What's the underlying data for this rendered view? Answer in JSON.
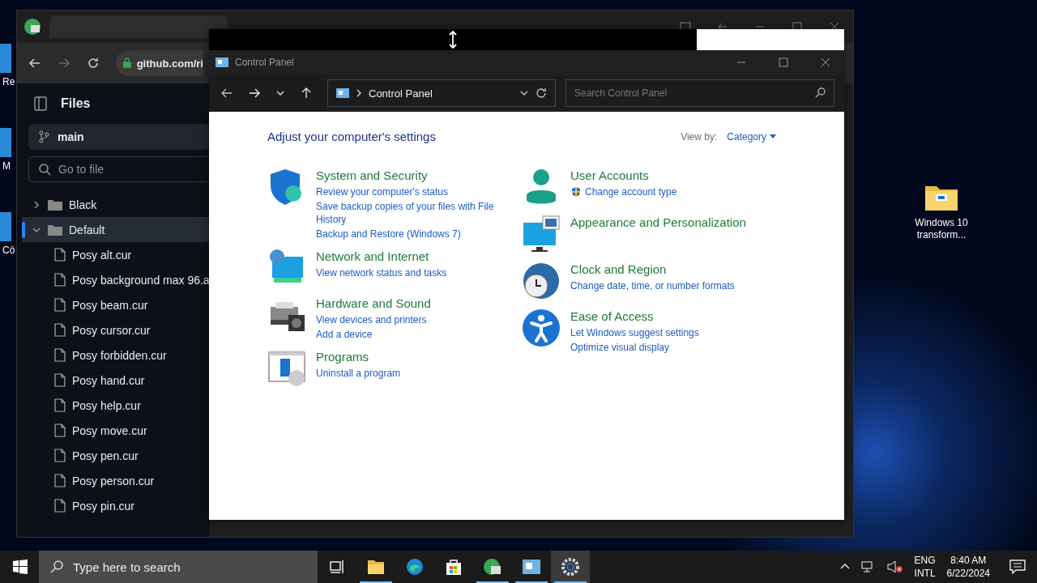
{
  "desktop": {
    "icons_left": [
      {
        "label": "Re"
      },
      {
        "label": "M"
      },
      {
        "label": "Cö"
      }
    ],
    "icons_right": [
      {
        "label": "Windows 10 transform..."
      }
    ]
  },
  "browser": {
    "address": "github.com/ri",
    "files_title": "Files",
    "branch": "main",
    "go_to_file": {
      "placeholder": "Go to file"
    },
    "tree": [
      {
        "name": "Black",
        "kind": "folder",
        "expanded": false,
        "selected": false
      },
      {
        "name": "Default",
        "kind": "folder",
        "expanded": true,
        "selected": true,
        "children": [
          {
            "name": "Posy alt.cur",
            "kind": "file"
          },
          {
            "name": "Posy background max 96.a",
            "kind": "file"
          },
          {
            "name": "Posy beam.cur",
            "kind": "file"
          },
          {
            "name": "Posy cursor.cur",
            "kind": "file"
          },
          {
            "name": "Posy forbidden.cur",
            "kind": "file"
          },
          {
            "name": "Posy hand.cur",
            "kind": "file"
          },
          {
            "name": "Posy help.cur",
            "kind": "file"
          },
          {
            "name": "Posy move.cur",
            "kind": "file"
          },
          {
            "name": "Posy pen.cur",
            "kind": "file"
          },
          {
            "name": "Posy person.cur",
            "kind": "file"
          },
          {
            "name": "Posy pin.cur",
            "kind": "file"
          }
        ]
      }
    ]
  },
  "control_panel": {
    "title": "Control Panel",
    "breadcrumb": "Control Panel",
    "search": {
      "placeholder": "Search Control Panel"
    },
    "heading": "Adjust your computer's settings",
    "view_by_label": "View by:",
    "view_by_value": "Category",
    "columns": [
      [
        {
          "title": "System and Security",
          "kind": "shield",
          "links": [
            {
              "text": "Review your computer's status",
              "uac": false
            },
            {
              "text": "Save backup copies of your files with File History",
              "uac": false
            },
            {
              "text": "Backup and Restore (Windows 7)",
              "uac": false
            }
          ]
        },
        {
          "title": "Network and Internet",
          "kind": "network",
          "links": [
            {
              "text": "View network status and tasks",
              "uac": false
            }
          ]
        },
        {
          "title": "Hardware and Sound",
          "kind": "hardware",
          "links": [
            {
              "text": "View devices and printers",
              "uac": false
            },
            {
              "text": "Add a device",
              "uac": false
            }
          ]
        },
        {
          "title": "Programs",
          "kind": "programs",
          "links": [
            {
              "text": "Uninstall a program",
              "uac": false
            }
          ]
        }
      ],
      [
        {
          "title": "User Accounts",
          "kind": "user",
          "links": [
            {
              "text": "Change account type",
              "uac": true
            }
          ]
        },
        {
          "title": "Appearance and Personalization",
          "kind": "appearance"
        },
        {
          "title": "Clock and Region",
          "kind": "clock",
          "links": [
            {
              "text": "Change date, time, or number formats",
              "uac": false
            }
          ]
        },
        {
          "title": "Ease of Access",
          "kind": "access",
          "links": [
            {
              "text": "Let Windows suggest settings",
              "uac": false
            },
            {
              "text": "Optimize visual display",
              "uac": false
            }
          ]
        }
      ]
    ]
  },
  "taskbar": {
    "search": {
      "placeholder": "Type here to search"
    },
    "apps": [
      {
        "kind": "taskview",
        "running": false,
        "active": false
      },
      {
        "kind": "explorer",
        "running": true,
        "active": false
      },
      {
        "kind": "edge",
        "running": false,
        "active": false
      },
      {
        "kind": "store",
        "running": false,
        "active": false
      },
      {
        "kind": "app",
        "running": true,
        "active": false
      },
      {
        "kind": "controlpanel",
        "running": true,
        "active": false
      },
      {
        "kind": "settings",
        "running": true,
        "active": true
      }
    ],
    "lang_top": "ENG",
    "lang_bottom": "INTL",
    "time": "8:40 AM",
    "date": "6/22/2024"
  }
}
